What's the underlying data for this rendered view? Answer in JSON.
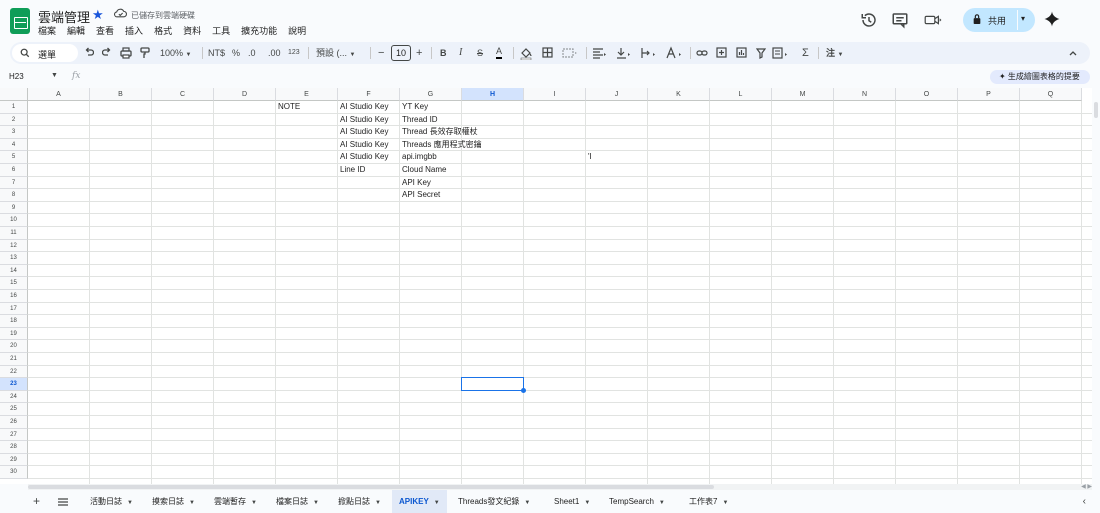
{
  "app": {
    "title": "雲端管理",
    "save_status": "已儲存到雲端硬碟",
    "menus": [
      "檔案",
      "編輯",
      "查看",
      "插入",
      "格式",
      "資料",
      "工具",
      "擴充功能",
      "說明"
    ],
    "share_label": "共用"
  },
  "toolbar": {
    "search_label": "選單",
    "zoom": "100%",
    "currency": "NT$",
    "percent": "%",
    "decrease_decimal": ".0",
    "increase_decimal": ".00",
    "number_format": "123",
    "font_name": "預設 (...",
    "font_size": "10",
    "more_label": "注"
  },
  "formula_bar": {
    "name_box": "H23",
    "fx": "fx",
    "ai_suggest": "✦ 生成繪圖表格的提要"
  },
  "grid": {
    "columns": [
      "A",
      "B",
      "C",
      "D",
      "E",
      "F",
      "G",
      "H",
      "I",
      "J",
      "K",
      "L",
      "M",
      "N",
      "O",
      "P",
      "Q"
    ],
    "rows": [
      "1",
      "2",
      "3",
      "4",
      "5",
      "6",
      "7",
      "8",
      "9",
      "10",
      "11",
      "12",
      "13",
      "14",
      "15",
      "16",
      "17",
      "18",
      "19",
      "20",
      "21",
      "22",
      "23",
      "24",
      "25",
      "26",
      "27",
      "28",
      "29",
      "30"
    ],
    "selected_cell": "H23",
    "cells": {
      "E1": "NOTE",
      "F1": "AI Studio Key",
      "F2": "AI Studio Key",
      "F3": "AI Studio Key",
      "F4": "AI Studio Key",
      "F5": "AI Studio Key",
      "F6": "Line ID",
      "G1": "YT Key",
      "G2": "Thread ID",
      "G3": "Thread 長效存取權杖",
      "G4": "Threads 應用程式密鑰",
      "G5": "api.imgbb",
      "G6": "Cloud Name",
      "G7": "API Key",
      "G8": "API Secret",
      "J5": "'I"
    }
  },
  "sheets": {
    "tabs": [
      "活動日誌",
      "摸索日誌",
      "雲端暫存",
      "檔案日誌",
      "掀點日誌",
      "APIKEY",
      "Threads發文紀錄",
      "Sheet1",
      "TempSearch",
      "工作表7"
    ],
    "active": "APIKEY",
    "add_label": "+"
  },
  "colors": {
    "accent": "#0b57d0",
    "share_bg": "#c2e7ff",
    "sheets_green": "#0f9d58"
  }
}
